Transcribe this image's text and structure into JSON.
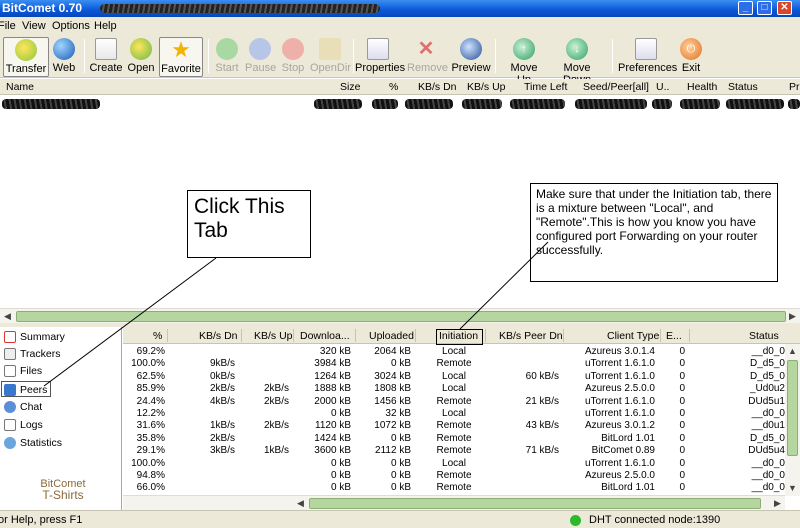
{
  "window": {
    "title": "BitComet 0.70",
    "minimize": "_",
    "maximize": "□",
    "close": "✕"
  },
  "menu": [
    "File",
    "View",
    "Options",
    "Help"
  ],
  "toolbar": {
    "transfer": "Transfer",
    "web": "Web",
    "create": "Create",
    "open": "Open",
    "favorite": "Favorite",
    "start": "Start",
    "pause": "Pause",
    "stop": "Stop",
    "opendir": "OpenDir",
    "properties": "Properties",
    "remove": "Remove",
    "preview": "Preview",
    "moveup": "Move Up",
    "movedown": "Move Down",
    "preferences": "Preferences",
    "exit": "Exit"
  },
  "task_columns": {
    "name": "Name",
    "size": "Size",
    "percent": "%",
    "down": "KB/s Dn",
    "up": "KB/s Up",
    "timeleft": "Time Left",
    "seedpeer": "Seed/Peer[all]",
    "u": "U..",
    "health": "Health",
    "status": "Status",
    "pr": "Pr"
  },
  "sidebar": {
    "items": [
      "Summary",
      "Trackers",
      "Files",
      "Peers",
      "Chat",
      "Logs",
      "Statistics"
    ],
    "promo_line1": "BitComet",
    "promo_line2": "T-Shirts"
  },
  "peer_columns": {
    "percent": "%",
    "down": "KB/s Dn",
    "up": "KB/s Up",
    "downloaded": "Downloa...",
    "uploaded": "Uploaded",
    "initiation": "Initiation",
    "peer_dn": "KB/s Peer Dn",
    "client": "Client Type",
    "e": "E...",
    "status": "Status"
  },
  "peers": [
    {
      "pct": "69.2%",
      "dn": "",
      "up": "",
      "dl": "320 kB",
      "ul": "2064 kB",
      "init": "Local",
      "pdn": "",
      "client": "Azureus 3.0.1.4",
      "e": "0",
      "status": "__d0_0"
    },
    {
      "pct": "100.0%",
      "dn": "9kB/s",
      "up": "",
      "dl": "3984 kB",
      "ul": "0 kB",
      "init": "Remote",
      "pdn": "",
      "client": "uTorrent 1.6.1.0",
      "e": "0",
      "status": "D_d5_0"
    },
    {
      "pct": "62.5%",
      "dn": "0kB/s",
      "up": "",
      "dl": "1264 kB",
      "ul": "3024 kB",
      "init": "Local",
      "pdn": "60 kB/s",
      "client": "uTorrent 1.6.1.0",
      "e": "0",
      "status": "D_d5_0"
    },
    {
      "pct": "85.9%",
      "dn": "2kB/s",
      "up": "2kB/s",
      "dl": "1888 kB",
      "ul": "1808 kB",
      "init": "Local",
      "pdn": "",
      "client": "Azureus 2.5.0.0",
      "e": "0",
      "status": "_Ud0u2"
    },
    {
      "pct": "24.4%",
      "dn": "4kB/s",
      "up": "2kB/s",
      "dl": "2000 kB",
      "ul": "1456 kB",
      "init": "Remote",
      "pdn": "21 kB/s",
      "client": "uTorrent 1.6.1.0",
      "e": "0",
      "status": "DUd5u1"
    },
    {
      "pct": "12.2%",
      "dn": "",
      "up": "",
      "dl": "0 kB",
      "ul": "32 kB",
      "init": "Local",
      "pdn": "",
      "client": "uTorrent 1.6.1.0",
      "e": "0",
      "status": "__d0_0"
    },
    {
      "pct": "31.6%",
      "dn": "1kB/s",
      "up": "2kB/s",
      "dl": "1120 kB",
      "ul": "1072 kB",
      "init": "Remote",
      "pdn": "43 kB/s",
      "client": "Azureus 3.0.1.2",
      "e": "0",
      "status": "__d0u1"
    },
    {
      "pct": "35.8%",
      "dn": "2kB/s",
      "up": "",
      "dl": "1424 kB",
      "ul": "0 kB",
      "init": "Remote",
      "pdn": "",
      "client": "BitLord 1.01",
      "e": "0",
      "status": "D_d5_0"
    },
    {
      "pct": "29.1%",
      "dn": "3kB/s",
      "up": "1kB/s",
      "dl": "3600 kB",
      "ul": "2112 kB",
      "init": "Remote",
      "pdn": "71 kB/s",
      "client": "BitComet 0.89",
      "e": "0",
      "status": "DUd5u4"
    },
    {
      "pct": "100.0%",
      "dn": "",
      "up": "",
      "dl": "0 kB",
      "ul": "0 kB",
      "init": "Local",
      "pdn": "",
      "client": "uTorrent 1.6.1.0",
      "e": "0",
      "status": "__d0_0"
    },
    {
      "pct": "94.8%",
      "dn": "",
      "up": "",
      "dl": "0 kB",
      "ul": "0 kB",
      "init": "Remote",
      "pdn": "",
      "client": "Azureus 2.5.0.0",
      "e": "0",
      "status": "__d0_0"
    },
    {
      "pct": "66.0%",
      "dn": "",
      "up": "",
      "dl": "0 kB",
      "ul": "0 kB",
      "init": "Remote",
      "pdn": "",
      "client": "BitLord 1.01",
      "e": "0",
      "status": "__d0_0"
    }
  ],
  "statusbar": {
    "help": "or Help, press F1",
    "dht": "DHT connected node:1390",
    "dht_color": "#2fb82f"
  },
  "annotations": {
    "click_tab": "Click This Tab",
    "note": "Make sure that under the Initiation tab, there is a mixture between \"Local\", and \"Remote\".This is how you know you have configured port Forwarding on your router successfully."
  },
  "colors": {
    "titlebar": "#0a57d8",
    "chrome": "#ece9d8",
    "scroll_thumb": "#b6d6a0"
  }
}
